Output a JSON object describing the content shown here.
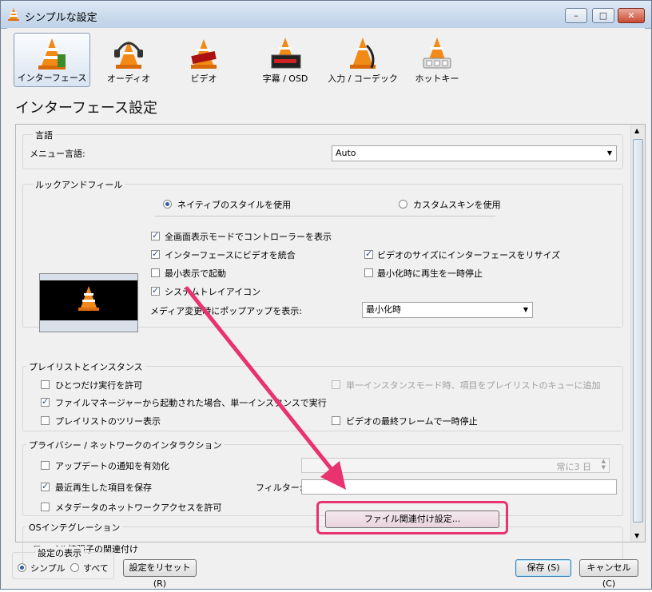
{
  "window": {
    "title": "シンプルな設定",
    "buttons": [
      "–",
      "□",
      "✕"
    ]
  },
  "toolbar": [
    {
      "name": "interface",
      "label": "インターフェース",
      "active": true
    },
    {
      "name": "audio",
      "label": "オーディオ"
    },
    {
      "name": "video",
      "label": "ビデオ"
    },
    {
      "name": "subtitles",
      "label": "字幕 / OSD"
    },
    {
      "name": "input",
      "label": "入力 / コーデック"
    },
    {
      "name": "hotkeys",
      "label": "ホットキー"
    }
  ],
  "section_title": "インターフェース設定",
  "language": {
    "title": "言語",
    "menu_label": "メニュー言語:",
    "menu_value": "Auto"
  },
  "look": {
    "title": "ルックアンドフィール",
    "native": "ネイティブのスタイルを使用",
    "custom": "カスタムスキンを使用",
    "fullscreen_controls": "全画面表示モードでコントローラーを表示",
    "integrate_video": "インターフェースにビデオを統合",
    "resize_interface": "ビデオのサイズにインターフェースをリサイズ",
    "start_minimal": "最小表示で起動",
    "pause_minimized": "最小化時に再生を一時停止",
    "systray": "システムトレイアイコン",
    "popup_label": "メディア変更時にポップアップを表示:",
    "popup_value": "最小化時"
  },
  "playlist": {
    "title": "プレイリストとインスタンス",
    "one_instance": "ひとつだけ実行を許可",
    "enqueue": "単一インスタンスモード時、項目をプレイリストのキューに追加",
    "file_manager": "ファイルマネージャーから起動された場合、単一インスタンスで実行",
    "tree": "プレイリストのツリー表示",
    "pause_last": "ビデオの最終フレームで一時停止"
  },
  "privacy": {
    "title": "プライバシー / ネットワークのインタラクション",
    "update_notify": "アップデートの通知を有効化",
    "update_days": "常に3 日",
    "recent": "最近再生した項目を保存",
    "filter_label": "フィルター:",
    "filter_value": "",
    "metadata": "メタデータのネットワークアクセスを許可"
  },
  "os": {
    "title": "OSインテグレーション",
    "assoc_label": "ファイル拡張子の関連付け",
    "assoc_button": "ファイル関連付け設定..."
  },
  "footer": {
    "show_title": "設定の表示",
    "simple": "シンプル",
    "all": "すべて",
    "reset": "設定をリセット (R)",
    "save": "保存 (S)",
    "cancel": "キャンセル (C)"
  },
  "colors": {
    "highlight": "#e8336f",
    "accent": "#2f5ea6"
  }
}
